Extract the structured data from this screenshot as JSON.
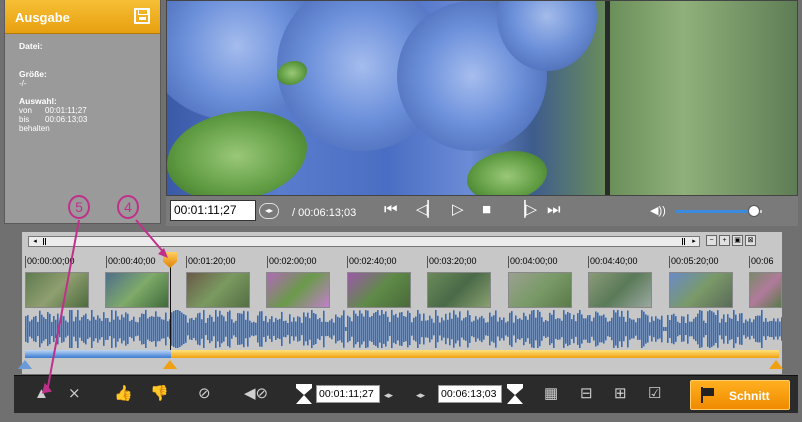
{
  "output_panel": {
    "title": "Ausgabe",
    "file_label": "Datei:",
    "size_label": "Größe:",
    "size_value": "-/-",
    "selection_label": "Auswahl:",
    "from_label": "von",
    "from_value": "00:01:11;27",
    "to_label": "bis",
    "to_value": "00:06:13;03",
    "keep_label": "behalten",
    "save_icon": "save-icon"
  },
  "player": {
    "current_timecode": "00:01:11;27",
    "total_time": "/ 00:06:13;03",
    "volume_level": 0.88
  },
  "timeline": {
    "ruler_labels": [
      "00:00:00;00",
      "00:00:40;00",
      "00:01:20;00",
      "00:02:00;00",
      "00:02:40;00",
      "00:03:20;00",
      "00:04:00;00",
      "00:04:40;00",
      "00:05:20;00",
      "00:06"
    ]
  },
  "toolbar": {
    "start_time": "00:01:11;27",
    "length_time": "00:06:13;03",
    "cut_label": "Schnitt"
  },
  "callouts": {
    "four": "4",
    "five": "5"
  },
  "colors": {
    "accent_orange": "#f0a010",
    "selection_blue": "#3a7ad0",
    "callout_magenta": "#c0308a"
  }
}
